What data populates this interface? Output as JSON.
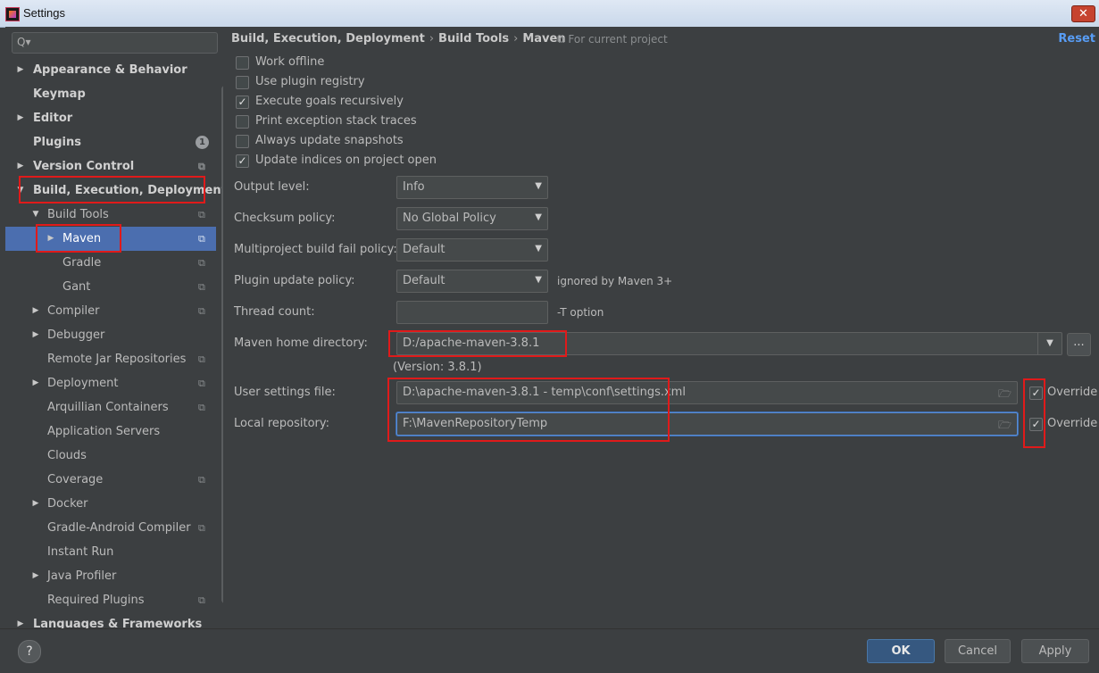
{
  "window": {
    "title": "Settings",
    "close_glyph": "✕"
  },
  "sidebar": {
    "search_placeholder": "",
    "search_icon": "Q▾",
    "items": [
      {
        "label": "Appearance & Behavior",
        "arrow": "▶",
        "bold": true
      },
      {
        "label": "Keymap",
        "bold": true
      },
      {
        "label": "Editor",
        "arrow": "▶",
        "bold": true
      },
      {
        "label": "Plugins",
        "bold": true,
        "badge": "1"
      },
      {
        "label": "Version Control",
        "arrow": "▶",
        "bold": true,
        "project": true
      },
      {
        "label": "Build, Execution, Deployment",
        "arrow": "▼",
        "bold": true
      },
      {
        "label": "Build Tools",
        "arrow": "▼",
        "project": true
      },
      {
        "label": "Maven",
        "arrow": "▶",
        "project": true,
        "selected": true
      },
      {
        "label": "Gradle",
        "project": true
      },
      {
        "label": "Gant",
        "project": true
      },
      {
        "label": "Compiler",
        "arrow": "▶",
        "project": true
      },
      {
        "label": "Debugger",
        "arrow": "▶"
      },
      {
        "label": "Remote Jar Repositories",
        "project": true
      },
      {
        "label": "Deployment",
        "arrow": "▶",
        "project": true
      },
      {
        "label": "Arquillian Containers",
        "project": true
      },
      {
        "label": "Application Servers"
      },
      {
        "label": "Clouds"
      },
      {
        "label": "Coverage",
        "project": true
      },
      {
        "label": "Docker",
        "arrow": "▶"
      },
      {
        "label": "Gradle-Android Compiler",
        "project": true
      },
      {
        "label": "Instant Run"
      },
      {
        "label": "Java Profiler",
        "arrow": "▶"
      },
      {
        "label": "Required Plugins",
        "project": true
      },
      {
        "label": "Languages & Frameworks",
        "arrow": "▶",
        "bold": true
      }
    ]
  },
  "header": {
    "breadcrumb": [
      "Build, Execution, Deployment",
      "Build Tools",
      "Maven"
    ],
    "breadcrumb_sep": "›",
    "scope": "For current project",
    "reset": "Reset"
  },
  "options": [
    {
      "label": "Work offline",
      "checked": false
    },
    {
      "label": "Use plugin registry",
      "checked": false
    },
    {
      "label": "Execute goals recursively",
      "checked": true
    },
    {
      "label": "Print exception stack traces",
      "checked": false
    },
    {
      "label": "Always update snapshots",
      "checked": false
    },
    {
      "label": "Update indices on project open",
      "checked": true
    }
  ],
  "fields": {
    "output_level": {
      "label": "Output level:",
      "value": "Info"
    },
    "checksum_policy": {
      "label": "Checksum policy:",
      "value": "No Global Policy"
    },
    "multiproject_fail": {
      "label": "Multiproject build fail policy:",
      "value": "Default"
    },
    "plugin_update": {
      "label": "Plugin update policy:",
      "value": "Default",
      "hint": "ignored by Maven 3+"
    },
    "thread_count": {
      "label": "Thread count:",
      "value": "",
      "hint": "-T option"
    },
    "maven_home": {
      "label": "Maven home directory:",
      "value": "D:/apache-maven-3.8.1",
      "version": "(Version: 3.8.1)",
      "browse": "..."
    },
    "user_settings": {
      "label": "User settings file:",
      "value": "D:\\apache-maven-3.8.1 - temp\\conf\\settings.xml",
      "override_label": "Override",
      "override": true
    },
    "local_repo": {
      "label": "Local repository:",
      "value": "F:\\MavenRepositoryTemp",
      "override_label": "Override",
      "override": true
    }
  },
  "footer": {
    "help": "?",
    "ok": "OK",
    "cancel": "Cancel",
    "apply": "Apply"
  },
  "colors": {
    "background": "#3c3f41",
    "selection": "#4b6eaf",
    "accent_link": "#589df6",
    "annotation_red": "#e01a1a"
  }
}
